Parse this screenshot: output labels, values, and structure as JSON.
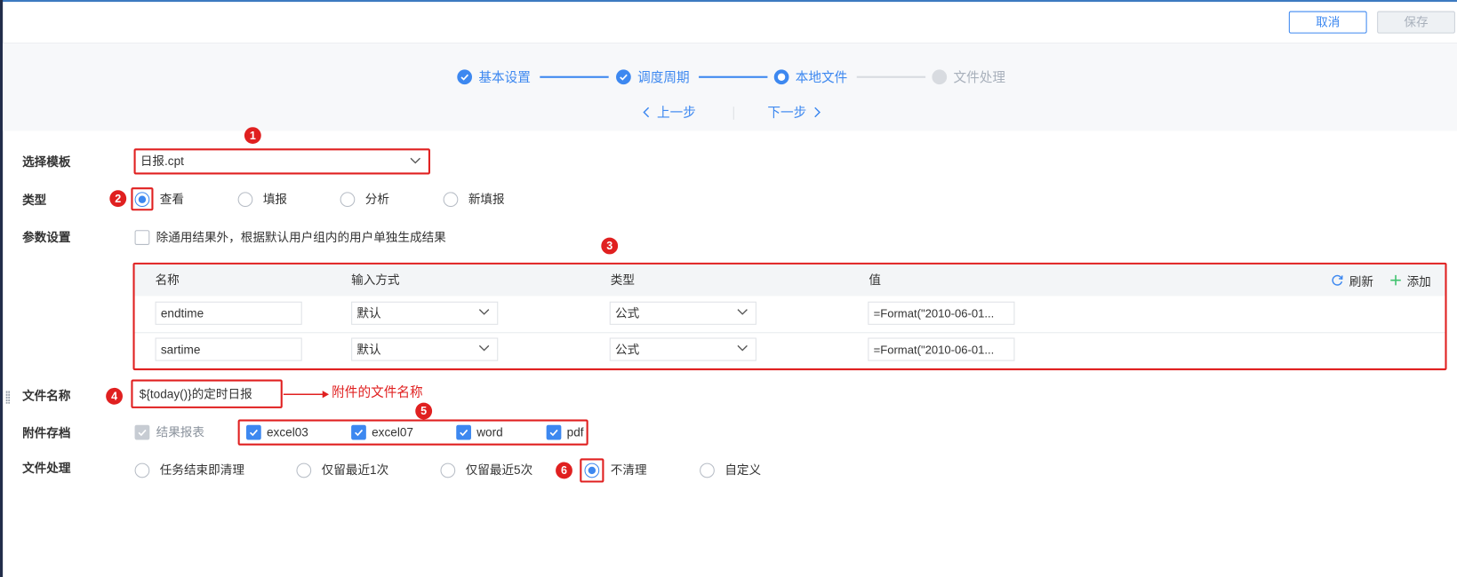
{
  "toolbar": {
    "cancel_label": "取消",
    "save_label": "保存"
  },
  "wizard": {
    "steps": [
      {
        "label": "基本设置",
        "state": "done"
      },
      {
        "label": "调度周期",
        "state": "done"
      },
      {
        "label": "本地文件",
        "state": "active"
      },
      {
        "label": "文件处理",
        "state": "pending"
      }
    ],
    "prev_label": "上一步",
    "next_label": "下一步"
  },
  "form": {
    "template": {
      "label": "选择模板",
      "value": "日报.cpt"
    },
    "type": {
      "label": "类型",
      "options": [
        "查看",
        "填报",
        "分析",
        "新填报"
      ],
      "selected": "查看"
    },
    "params": {
      "label": "参数设置",
      "checkbox_label": "除通用结果外，根据默认用户组内的用户单独生成结果",
      "checkbox_checked": false,
      "columns": [
        "名称",
        "输入方式",
        "类型",
        "值"
      ],
      "refresh_label": "刷新",
      "add_label": "添加",
      "rows": [
        {
          "name": "endtime",
          "input_mode": "默认",
          "type": "公式",
          "value": "=Format(\"2010-06-01..."
        },
        {
          "name": "sartime",
          "input_mode": "默认",
          "type": "公式",
          "value": "=Format(\"2010-06-01..."
        }
      ]
    },
    "filename": {
      "label": "文件名称",
      "value": "${today()}的定时日报",
      "annotation": "附件的文件名称"
    },
    "attachment": {
      "label": "附件存档",
      "result_report_label": "结果报表",
      "formats": [
        {
          "label": "excel03",
          "checked": true
        },
        {
          "label": "excel07",
          "checked": true
        },
        {
          "label": "word",
          "checked": true
        },
        {
          "label": "pdf",
          "checked": true
        }
      ]
    },
    "file_handling": {
      "label": "文件处理",
      "options": [
        "任务结束即清理",
        "仅留最近1次",
        "仅留最近5次",
        "不清理",
        "自定义"
      ],
      "selected": "不清理"
    }
  },
  "badges": [
    "1",
    "2",
    "3",
    "4",
    "5",
    "6"
  ],
  "colors": {
    "accent": "#3d88f0",
    "highlight_red": "#e02020",
    "add_green": "#3ec26d",
    "top_bar": "#3d7ac0"
  },
  "icons": [
    "check-icon",
    "chevron-left-icon",
    "chevron-right-icon",
    "chevron-down-icon",
    "refresh-icon",
    "plus-icon"
  ]
}
